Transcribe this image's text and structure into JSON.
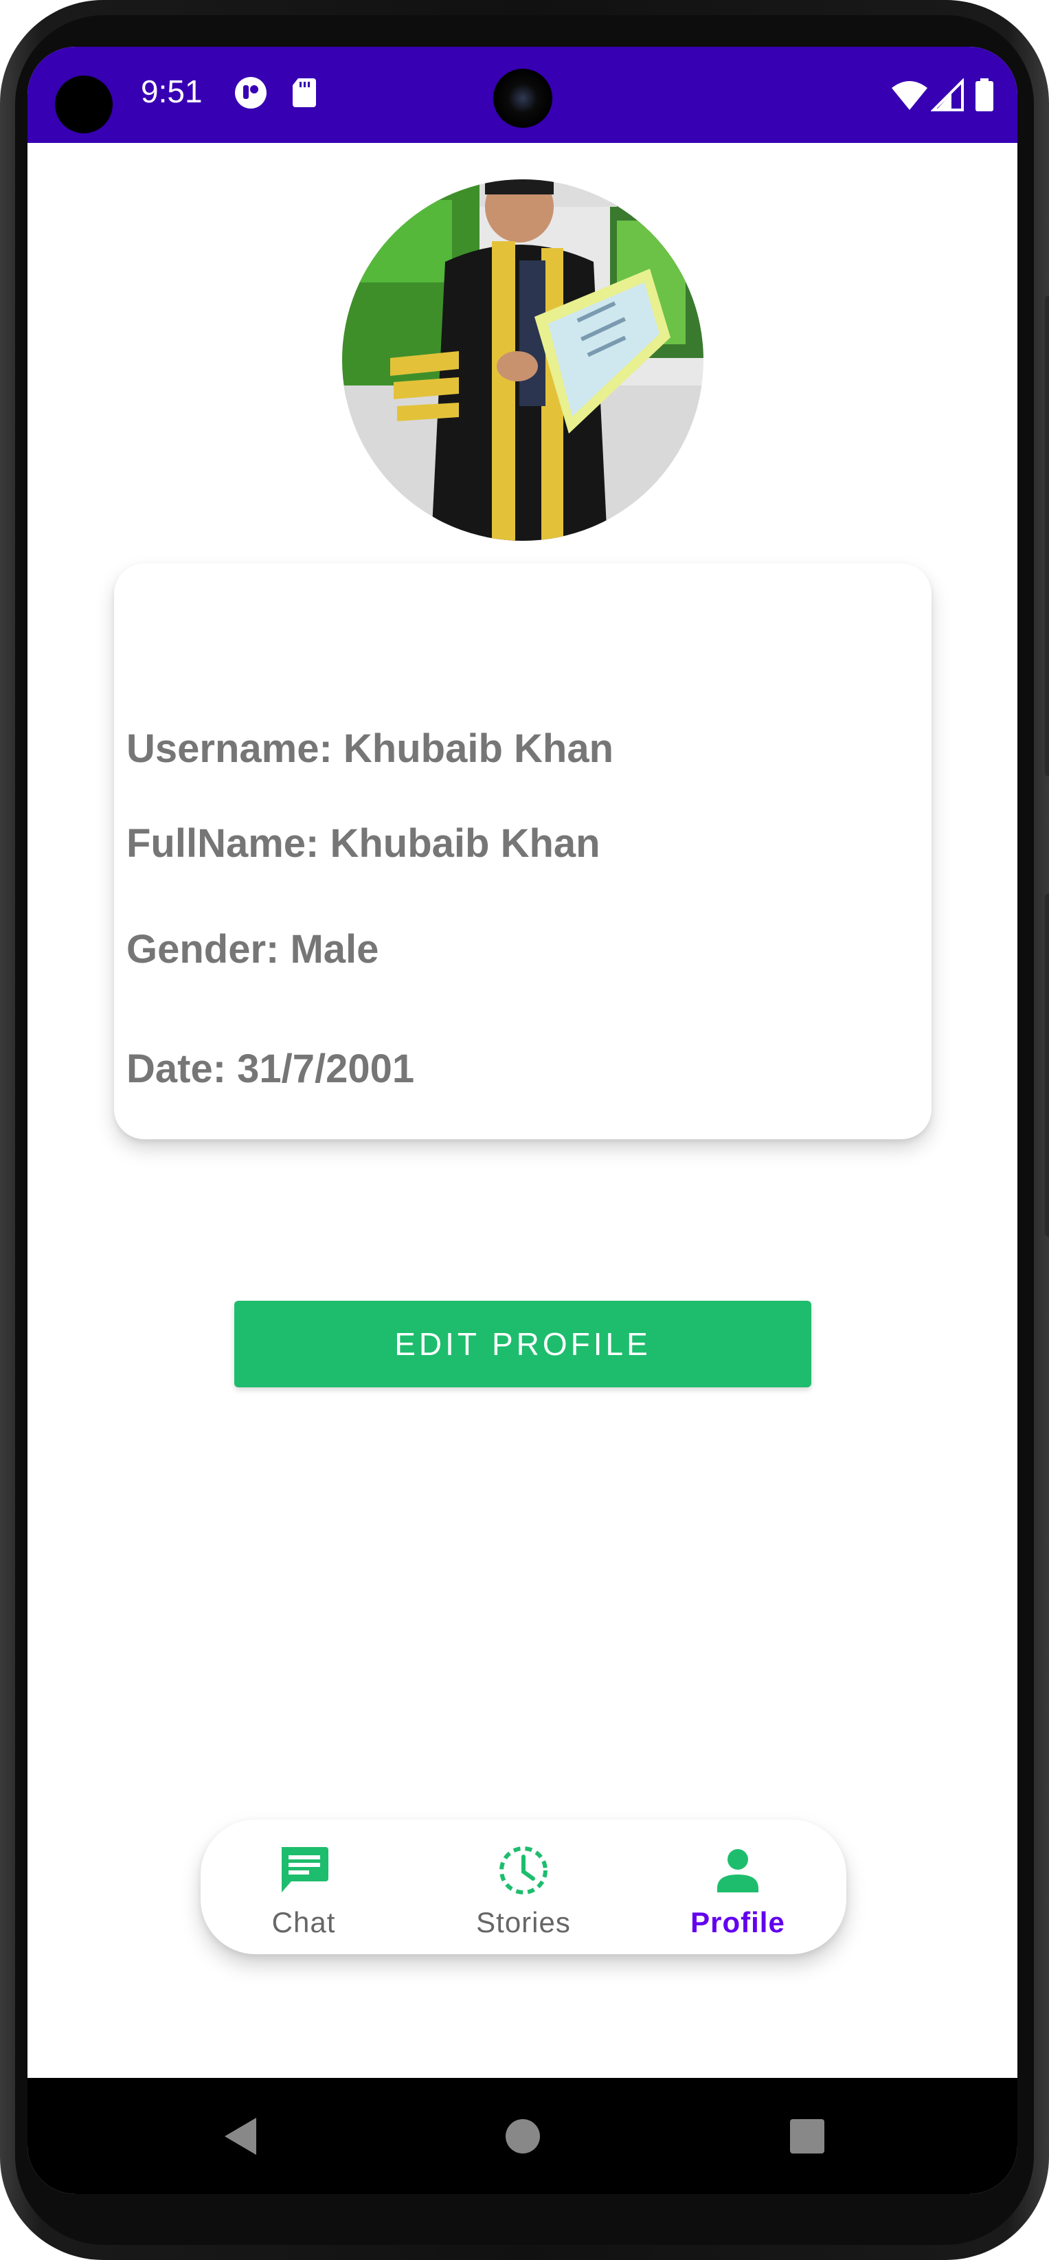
{
  "status_bar": {
    "time": "9:51",
    "background_color": "#3700b3"
  },
  "profile": {
    "avatar_alt": "profile photo",
    "fields": {
      "username": "Username: Khubaib Khan",
      "fullname": "FullName: Khubaib Khan",
      "gender": "Gender: Male",
      "date": "Date: 31/7/2001"
    }
  },
  "actions": {
    "edit_profile_label": "EDIT PROFILE",
    "accent_color": "#1ebd6d"
  },
  "bottom_nav": {
    "items": [
      {
        "label": "Chat",
        "icon": "chat-icon",
        "active": false
      },
      {
        "label": "Stories",
        "icon": "stories-icon",
        "active": false
      },
      {
        "label": "Profile",
        "icon": "person-icon",
        "active": true
      }
    ],
    "active_color": "#6200ee",
    "icon_color": "#1ebd6d"
  },
  "system_nav": {
    "buttons": [
      "back-icon",
      "home-icon",
      "recents-icon"
    ]
  }
}
